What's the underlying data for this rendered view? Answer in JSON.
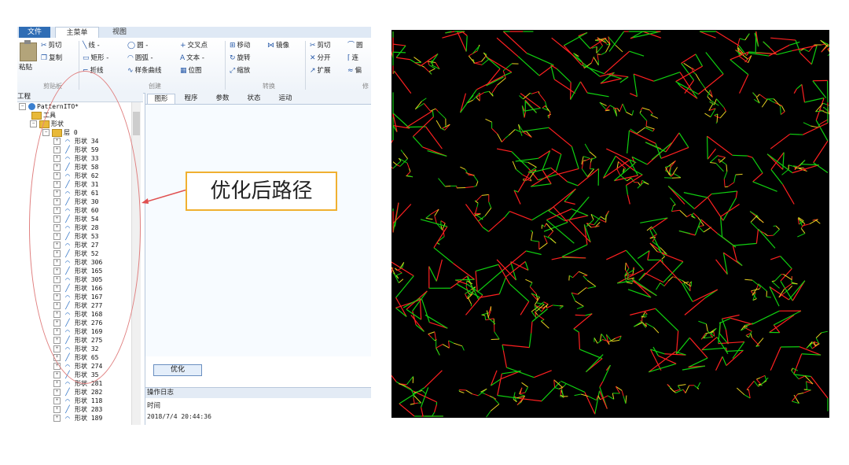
{
  "menu": {
    "file": "文件",
    "home": "主菜单",
    "view": "视图"
  },
  "ribbon": {
    "paste": "粘贴",
    "cut": "剪切",
    "copy": "复制",
    "line": "线 -",
    "rect": "矩形 -",
    "polyline": "折线",
    "circle": "圆 -",
    "arc": "圆弧 -",
    "spline": "样条曲线",
    "intersect": "交叉点",
    "text": "文本 -",
    "bitmap": "位图",
    "move": "移动",
    "mirror": "镜像",
    "rotate": "旋转",
    "scale": "缩放",
    "trim": "剪切",
    "split": "分开",
    "extend": "扩展",
    "round": "圆",
    "connect": "连",
    "offset": "偏",
    "group_clipboard": "剪贴板",
    "group_create": "创建",
    "group_transform": "转换",
    "group_modify": "修"
  },
  "tree": {
    "title": "工程",
    "project": "PatternITO*",
    "tools": "工具",
    "shapes": "形状",
    "layer": "层 0",
    "items": [
      "形状 34",
      "形状 59",
      "形状 33",
      "形状 58",
      "形状 62",
      "形状 31",
      "形状 61",
      "形状 30",
      "形状 60",
      "形状 54",
      "形状 28",
      "形状 53",
      "形状 27",
      "形状 52",
      "形状 306",
      "形状 165",
      "形状 305",
      "形状 166",
      "形状 167",
      "形状 277",
      "形状 168",
      "形状 276",
      "形状 169",
      "形状 275",
      "形状 32",
      "形状 65",
      "形状 274",
      "形状 35",
      "形状 281",
      "形状 282",
      "形状 118",
      "形状 283",
      "形状 189"
    ]
  },
  "panel": {
    "tabs": [
      "图形",
      "程序",
      "参数",
      "状态",
      "运动"
    ],
    "optimize_button": "优化",
    "log_title": "操作日志",
    "log_header": "时间",
    "log_row": "2018/7/4 20:44:36"
  },
  "callout": "优化后路径",
  "colors": {
    "accent": "#2f6db5",
    "callout_border": "#f0b030",
    "arrow": "#e05050",
    "path_red": "#ff2020",
    "path_green": "#10d010",
    "plot_bg": "#000000"
  }
}
